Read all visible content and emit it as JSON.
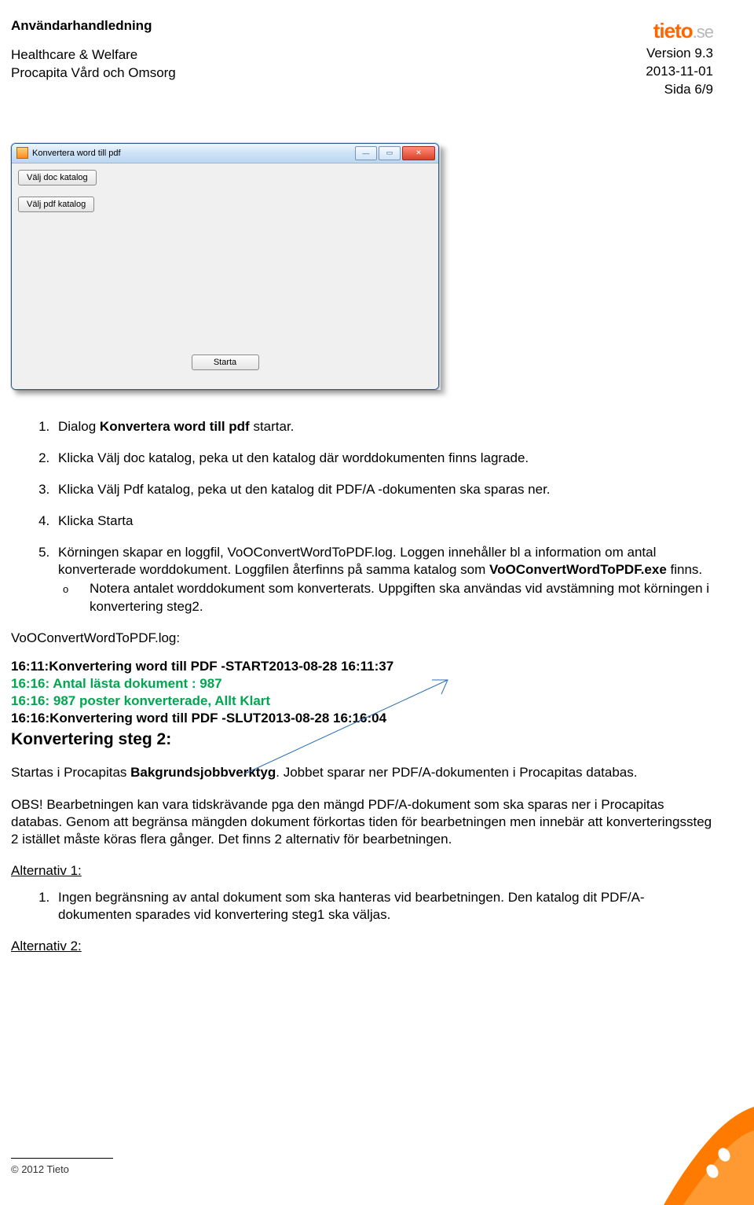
{
  "header": {
    "doc_title": "Användarhandledning",
    "org": "Healthcare & Welfare",
    "product": "Procapita Vård och Omsorg",
    "version": "Version 9.3",
    "date": "2013-11-01",
    "page": "Sida 6/9",
    "logo_name": "tieto",
    "logo_suffix": ".se"
  },
  "dialog": {
    "title": "Konvertera word till pdf",
    "btn_doc": "Välj doc katalog",
    "btn_pdf": "Välj pdf katalog",
    "btn_start": "Starta"
  },
  "list": {
    "i1_a": "Dialog ",
    "i1_b": "Konvertera word till pdf",
    "i1_c": " startar.",
    "i2": "Klicka Välj doc katalog, peka ut den katalog där worddokumenten finns lagrade.",
    "i3": "Klicka Välj Pdf katalog, peka ut den katalog dit PDF/A -dokumenten ska sparas ner.",
    "i4": "Klicka Starta",
    "i5_a": "Körningen skapar en loggfil, VoOConvertWordToPDF.log. Loggen innehåller bl a information om antal konverterade worddokument. Loggfilen återfinns på samma katalog som ",
    "i5_b": "VoOConvertWordToPDF.exe",
    "i5_c": " finns.",
    "i5_sub": "Notera antalet worddokument som konverterats. Uppgiften ska användas vid avstämning mot körningen i konvertering steg2."
  },
  "log": {
    "label": "VoOConvertWordToPDF.log:",
    "l1": "16:11:Konvertering word till PDF -START2013-08-28 16:11:37",
    "l2": "16:16: Antal lästa dokument : 987",
    "l3": "16:16: 987 poster konverterade, Allt Klart",
    "l4": "16:16:Konvertering word till PDF -SLUT2013-08-28 16:16:04"
  },
  "step2": {
    "heading": "Konvertering steg 2:",
    "p1_a": "Startas i Procapitas ",
    "p1_b": "Bakgrundsjobbverktyg",
    "p1_c": ". Jobbet sparar ner PDF/A-dokumenten i Procapitas databas.",
    "p2": "OBS! Bearbetningen kan vara tidskrävande pga den mängd PDF/A-dokument som ska sparas ner i Procapitas databas. Genom att begränsa mängden dokument förkortas tiden för bearbetningen men innebär att konverteringssteg 2 istället måste köras flera gånger. Det finns 2 alternativ för bearbetningen.",
    "alt1_label": "Alternativ 1:",
    "alt1_item": "Ingen begränsning av antal dokument som ska hanteras vid bearbetningen. Den katalog dit PDF/A-dokumenten sparades vid konvertering steg1 ska väljas.",
    "alt2_label": "Alternativ 2:"
  },
  "footer": {
    "copyright": "© 2012 Tieto"
  }
}
